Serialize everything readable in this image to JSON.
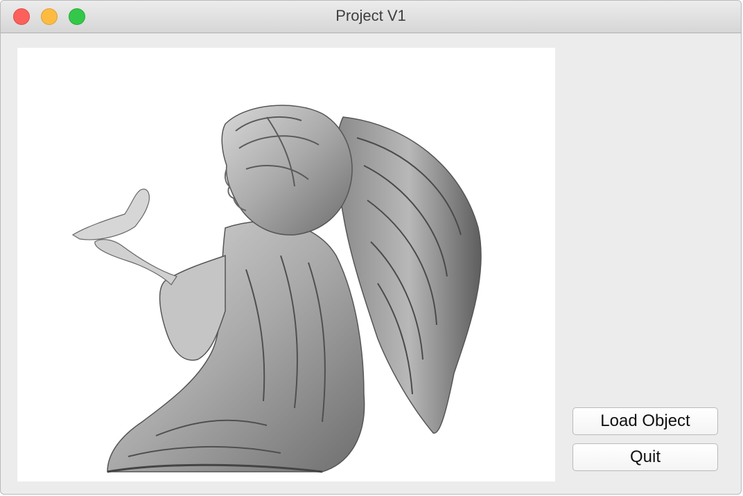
{
  "window": {
    "title": "Project V1"
  },
  "titlebar": {
    "buttons": [
      "close-icon",
      "minimize-icon",
      "zoom-icon"
    ],
    "colors": {
      "close": "#fc605b",
      "minimize": "#fdbc40",
      "zoom": "#34c84a"
    }
  },
  "viewport": {
    "content": "3d-model-render",
    "background": "#ffffff"
  },
  "controls": {
    "load_label": "Load Object",
    "quit_label": "Quit"
  }
}
